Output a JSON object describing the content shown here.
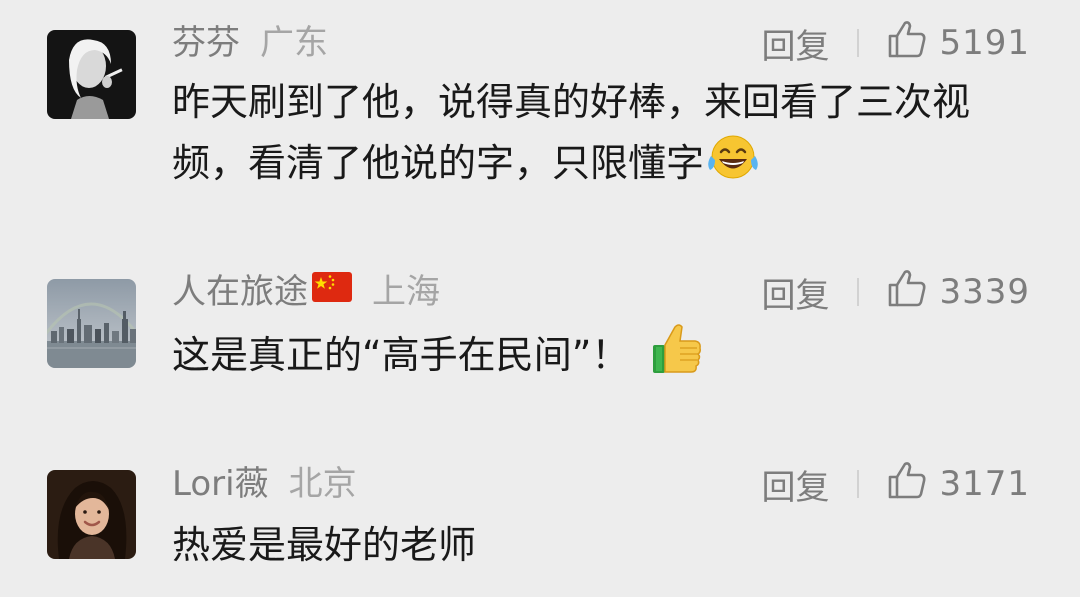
{
  "comments": [
    {
      "author": "芬芬",
      "location": "广东",
      "reply_label": "回复",
      "likes": "5191",
      "text": "昨天刷到了他，说得真的好棒，来回看了三次视频，看清了他说的字，只限懂字",
      "avatar": "woman-smoking-bw-avatar",
      "emoji": "laughing-tears-emoji"
    },
    {
      "author": "人在旅途",
      "author_flag": "china-flag-icon",
      "location": "上海",
      "reply_label": "回复",
      "likes": "3339",
      "text": "这是真正的“高手在民间”！",
      "avatar": "city-skyline-avatar",
      "emoji": "thumbs-up-emoji"
    },
    {
      "author": "Lori薇",
      "location": "北京",
      "reply_label": "回复",
      "likes": "3171",
      "text": "热爱是最好的老师",
      "avatar": "woman-portrait-avatar"
    }
  ],
  "colors": {
    "background": "#ededed",
    "author": "#7d7d7d",
    "location": "#a5a5a5",
    "text": "#191919"
  }
}
